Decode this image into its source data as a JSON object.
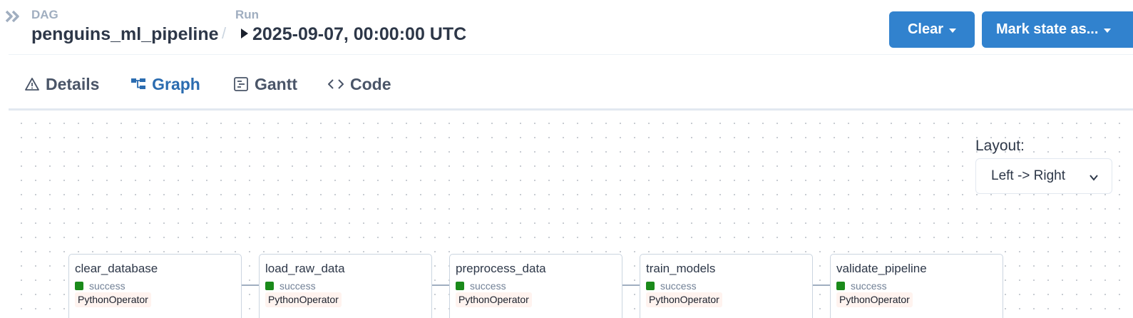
{
  "breadcrumb": {
    "dag_label": "DAG",
    "dag_id": "penguins_ml_pipeline",
    "separator": "/",
    "run_label": "Run",
    "run_id": "2025-09-07, 00:00:00 UTC"
  },
  "actions": {
    "clear_label": "Clear",
    "mark_state_label": "Mark state as..."
  },
  "tabs": [
    {
      "label": "Details",
      "icon": "warning-triangle-icon",
      "active": false
    },
    {
      "label": "Graph",
      "icon": "graph-icon",
      "active": true
    },
    {
      "label": "Gantt",
      "icon": "gantt-icon",
      "active": false
    },
    {
      "label": "Code",
      "icon": "code-icon",
      "active": false
    }
  ],
  "graph": {
    "layout_label": "Layout:",
    "layout_value": "Left -> Right",
    "tasks": [
      {
        "name": "clear_database",
        "status": "success",
        "operator": "PythonOperator"
      },
      {
        "name": "load_raw_data",
        "status": "success",
        "operator": "PythonOperator"
      },
      {
        "name": "preprocess_data",
        "status": "success",
        "operator": "PythonOperator"
      },
      {
        "name": "train_models",
        "status": "success",
        "operator": "PythonOperator"
      },
      {
        "name": "validate_pipeline",
        "status": "success",
        "operator": "PythonOperator"
      }
    ]
  },
  "colors": {
    "primary_button": "#3182ce",
    "active_tab": "#2b6cb0",
    "status_success": "#1a8a1a",
    "operator_badge": "#fff3ef"
  }
}
